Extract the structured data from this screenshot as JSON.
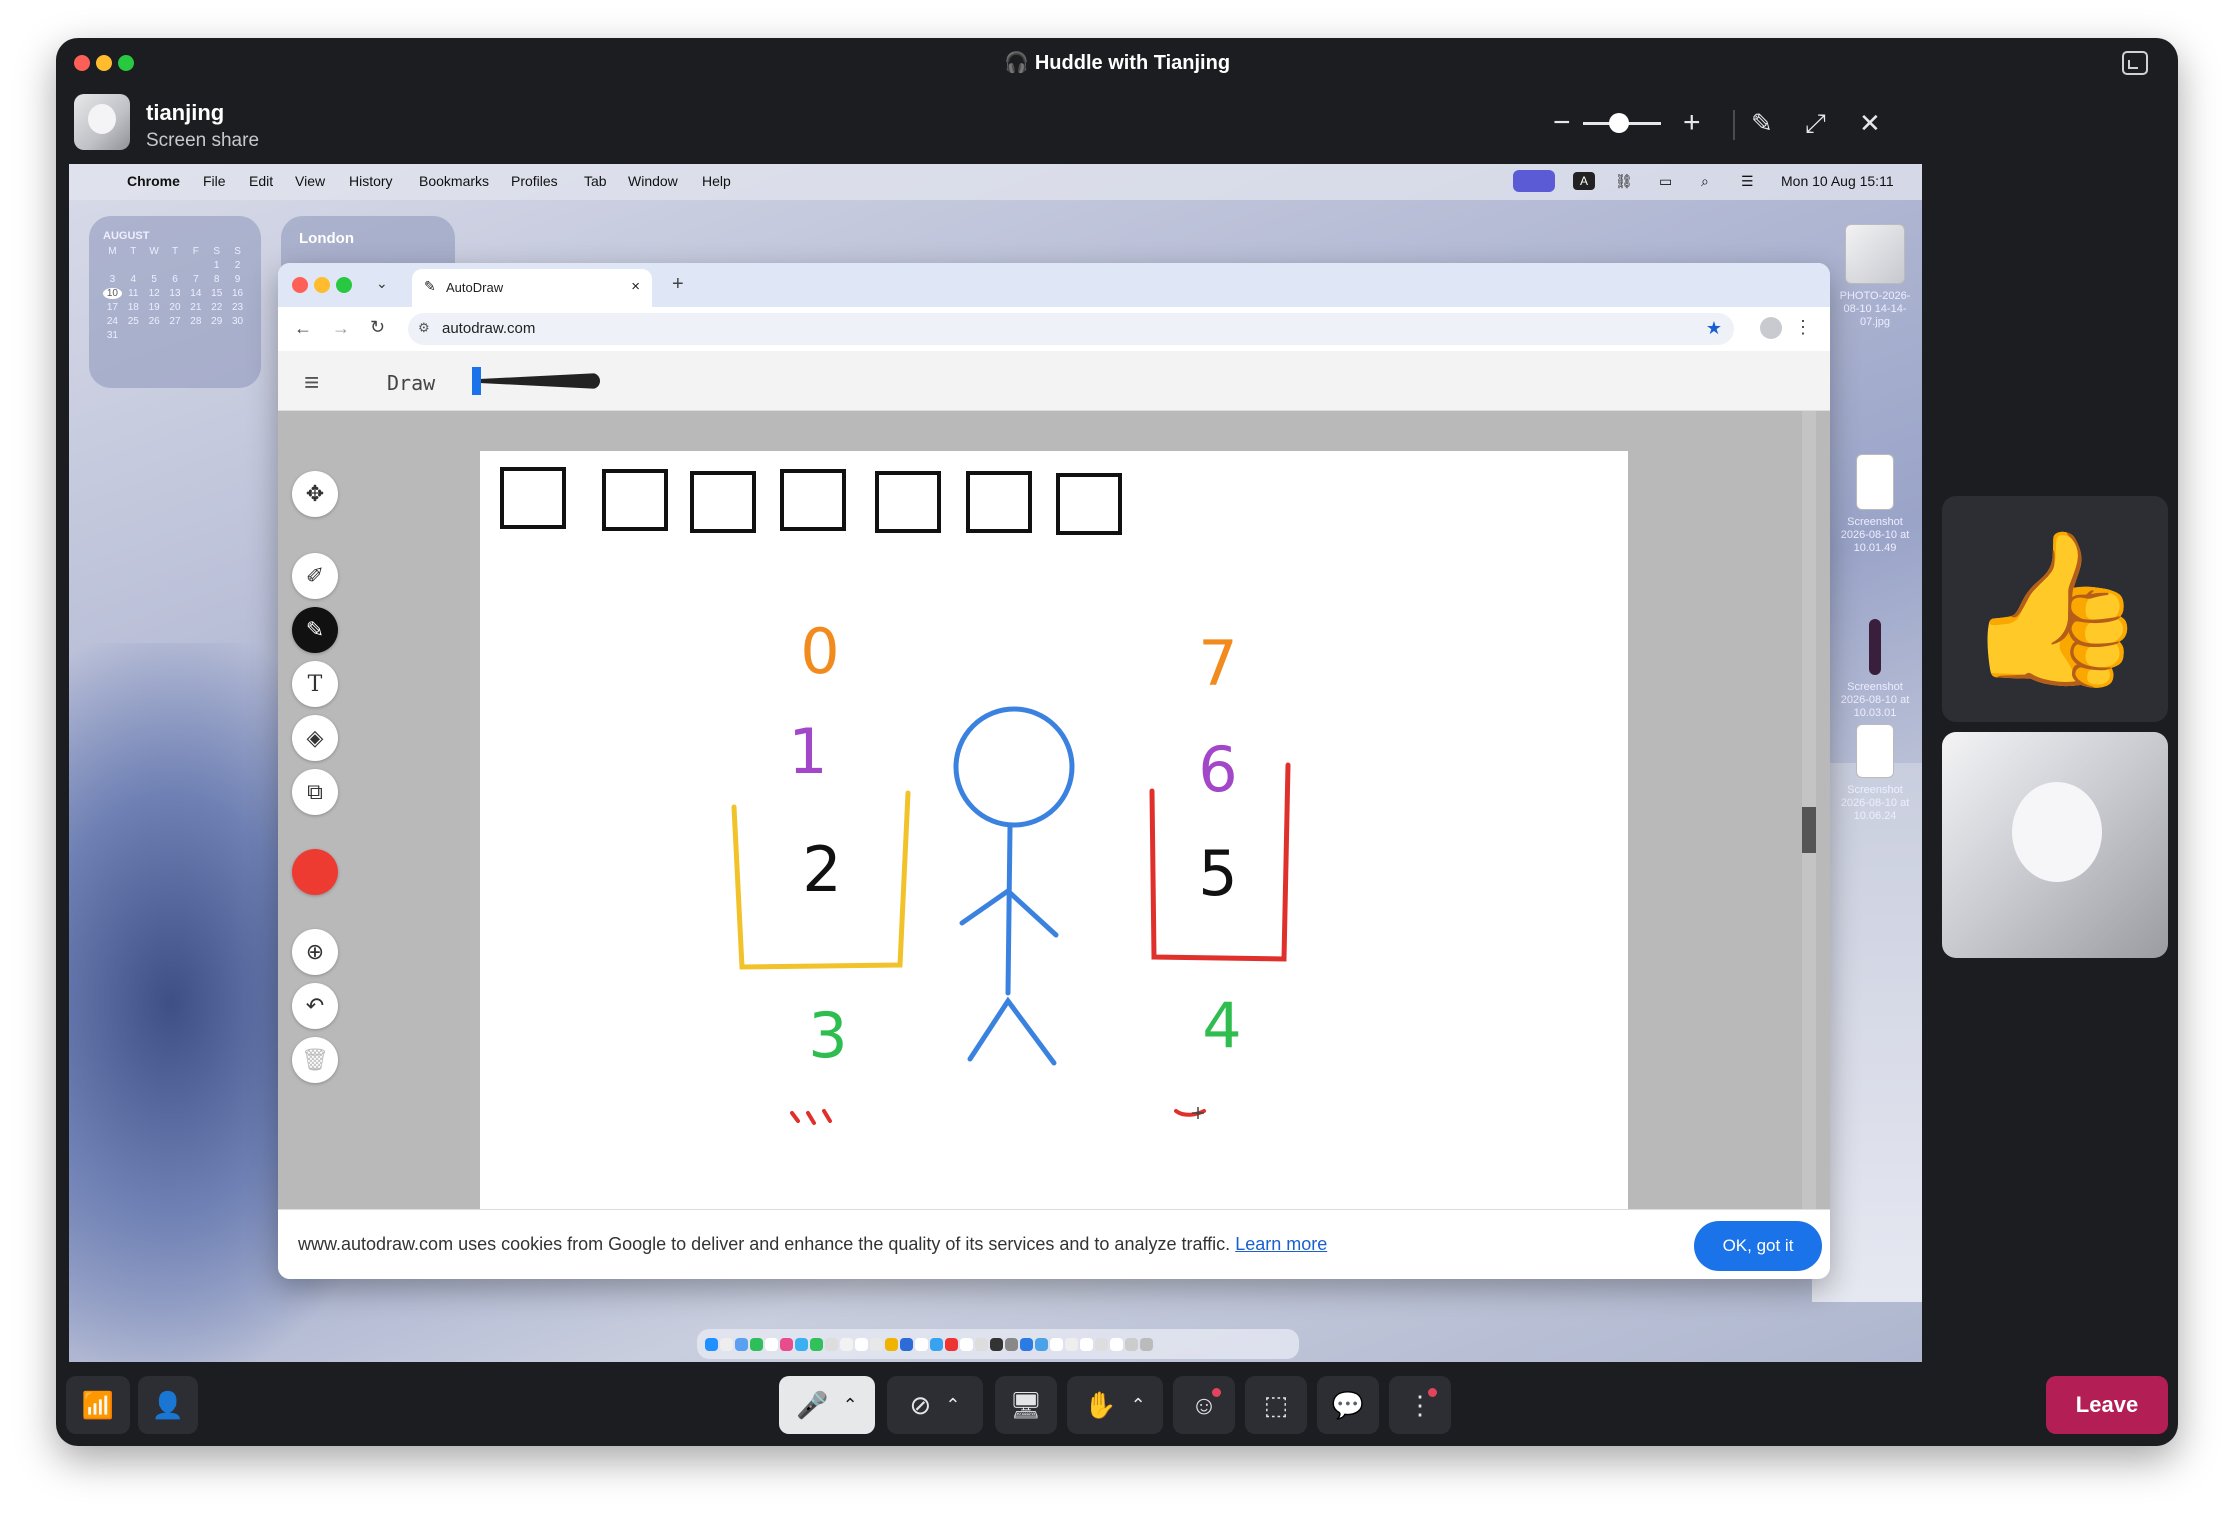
{
  "window": {
    "title": "Huddle with Tianjing",
    "presenter_name": "tianjing",
    "presenter_status": "Screen share"
  },
  "menubar": {
    "app": "Chrome",
    "items": [
      "File",
      "Edit",
      "View",
      "History",
      "Bookmarks",
      "Profiles",
      "Tab",
      "Window",
      "Help"
    ],
    "clock": "Mon 10 Aug  15:11"
  },
  "widgets": {
    "calendar_month": "AUGUST",
    "weekdays": [
      "M",
      "T",
      "W",
      "T",
      "F",
      "S",
      "S"
    ],
    "days": [
      "",
      "",
      "",
      "",
      "",
      "1",
      "2",
      "3",
      "4",
      "5",
      "6",
      "7",
      "8",
      "9",
      "10",
      "11",
      "12",
      "13",
      "14",
      "15",
      "16",
      "17",
      "18",
      "19",
      "20",
      "21",
      "22",
      "23",
      "24",
      "25",
      "26",
      "27",
      "28",
      "29",
      "30",
      "31"
    ],
    "clock_city": "London"
  },
  "desktop": {
    "icon1": "PHOTO-2026-08-10 14-14-07.jpg",
    "icon2": "Screenshot 2026-08-10 at 10.01.49",
    "icon3": "Screenshot 2026-08-10 at 10.03.01",
    "icon4": "Screenshot 2026-08-10 at 10.06.24"
  },
  "browser": {
    "tab_title": "AutoDraw",
    "url": "autodraw.com",
    "mode_label": "Draw",
    "cookie_text": "www.autodraw.com uses cookies from Google to deliver and enhance the quality of its services and to analyze traffic.",
    "cookie_link": "Learn more",
    "cookie_ok": "OK, got it"
  },
  "drawing": {
    "labels": [
      "0",
      "1",
      "2",
      "3",
      "7",
      "6",
      "5",
      "4"
    ]
  },
  "controls": {
    "leave_label": "Leave"
  },
  "colors": {
    "accent_leave": "#b31e55",
    "ok_button": "#1a73e8",
    "active_color": "#ee3b32"
  }
}
